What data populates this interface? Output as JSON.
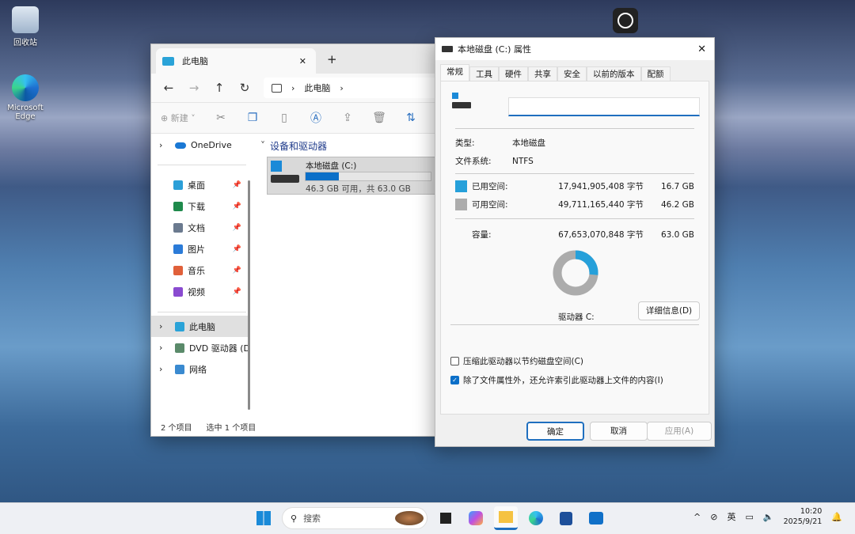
{
  "desktop": {
    "icons": [
      {
        "label": "回收站"
      },
      {
        "label": "Microsoft Edge"
      }
    ]
  },
  "explorer": {
    "tab_title": "此电脑",
    "new_tab": "+",
    "close": "✕",
    "breadcrumb": [
      "此电脑"
    ],
    "toolbar": {
      "new_label": "新建"
    },
    "sidebar": {
      "onedrive": "OneDrive",
      "items": [
        {
          "label": "桌面",
          "color": "#2b9fd8"
        },
        {
          "label": "下载",
          "color": "#1f8a4c"
        },
        {
          "label": "文档",
          "color": "#6b7a8f"
        },
        {
          "label": "图片",
          "color": "#2b7bd8"
        },
        {
          "label": "音乐",
          "color": "#e0603a"
        },
        {
          "label": "视频",
          "color": "#8a4bd0"
        }
      ],
      "this_pc": "此电脑",
      "dvd": "DVD 驱动器 (D",
      "network": "网络"
    },
    "section": "设备和驱动器",
    "drive": {
      "name": "本地磁盘 (C:)",
      "detail": "46.3 GB 可用，共 63.0 GB",
      "used_fraction": 0.265
    },
    "status": {
      "count": "2 个项目",
      "selected": "选中 1 个项目"
    }
  },
  "properties": {
    "title": "本地磁盘 (C:) 属性",
    "close": "✕",
    "tabs": [
      "常规",
      "工具",
      "硬件",
      "共享",
      "安全",
      "以前的版本",
      "配额"
    ],
    "name_value": "",
    "type_label": "类型:",
    "type_value": "本地磁盘",
    "fs_label": "文件系统:",
    "fs_value": "NTFS",
    "used": {
      "label": "已用空间:",
      "bytes": "17,941,905,408 字节",
      "size": "16.7 GB",
      "color": "#26a0da"
    },
    "free": {
      "label": "可用空间:",
      "bytes": "49,711,165,440 字节",
      "size": "46.2 GB",
      "color": "#acacac"
    },
    "capacity": {
      "label": "容量:",
      "bytes": "67,653,070,848 字节",
      "size": "63.0 GB"
    },
    "drive_label": "驱动器 C:",
    "details_button": "详细信息(D)",
    "compress": {
      "label": "压缩此驱动器以节约磁盘空间(C)",
      "checked": false
    },
    "index": {
      "label": "除了文件属性外，还允许索引此驱动器上文件的内容(I)",
      "checked": true
    },
    "ok": "确定",
    "cancel": "取消",
    "apply": "应用(A)"
  },
  "taskbar": {
    "search_placeholder": "搜索",
    "ime": "英",
    "time": "10:20",
    "date": "2025/9/21"
  }
}
